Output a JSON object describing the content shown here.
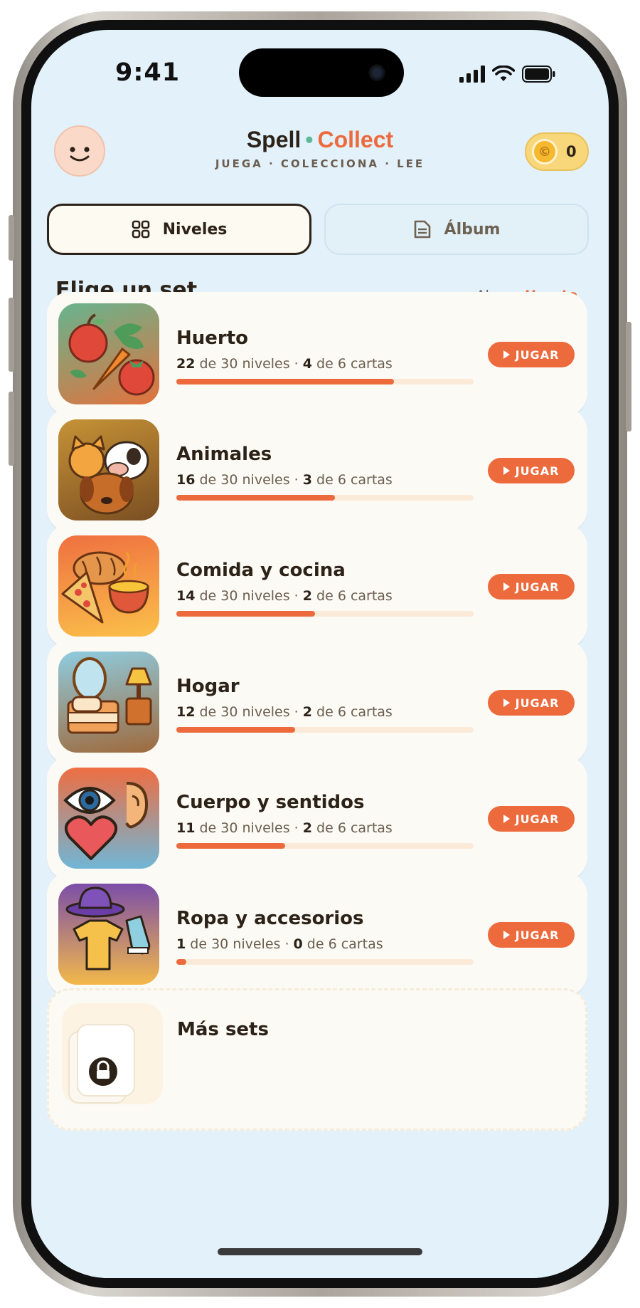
{
  "status": {
    "time": "9:41"
  },
  "app": {
    "title_part1": "Spell",
    "title_dot": "•",
    "title_part2": "Collect",
    "tagline": "JUEGA · COLECCIONA · LEE",
    "coin_symbol": "©",
    "coins": "0"
  },
  "tabs": [
    {
      "label": "Niveles",
      "icon": "grid-icon",
      "active": true
    },
    {
      "label": "Álbum",
      "icon": "album-icon",
      "active": false
    }
  ],
  "section": {
    "title": "Elige un set",
    "current_label": "Ahora:",
    "current_value": "Huerto"
  },
  "sets": [
    {
      "name": "Huerto",
      "levels_done": "22",
      "levels_text": " de 30 niveles · ",
      "cards_done": "4",
      "cards_text": " de 6 cartas",
      "progress": 0.733,
      "play_label": "JUGAR",
      "icon": "vegetables-icon"
    },
    {
      "name": "Animales",
      "levels_done": "16",
      "levels_text": " de 30 niveles · ",
      "cards_done": "3",
      "cards_text": " de 6 cartas",
      "progress": 0.533,
      "play_label": "JUGAR",
      "icon": "animals-icon"
    },
    {
      "name": "Comida y cocina",
      "levels_done": "14",
      "levels_text": " de 30 niveles · ",
      "cards_done": "2",
      "cards_text": " de 6 cartas",
      "progress": 0.467,
      "play_label": "JUGAR",
      "icon": "food-icon"
    },
    {
      "name": "Hogar",
      "levels_done": "12",
      "levels_text": " de 30 niveles · ",
      "cards_done": "2",
      "cards_text": " de 6 cartas",
      "progress": 0.4,
      "play_label": "JUGAR",
      "icon": "home-bed-icon"
    },
    {
      "name": "Cuerpo y sentidos",
      "levels_done": "11",
      "levels_text": " de 30 niveles · ",
      "cards_done": "2",
      "cards_text": " de 6 cartas",
      "progress": 0.367,
      "play_label": "JUGAR",
      "icon": "senses-icon"
    },
    {
      "name": "Ropa y accesorios",
      "levels_done": "1",
      "levels_text": " de 30 niveles · ",
      "cards_done": "0",
      "cards_text": " de 6 cartas",
      "progress": 0.033,
      "play_label": "JUGAR",
      "icon": "clothes-icon"
    }
  ],
  "more": {
    "title": "Más sets",
    "icon": "lock-icon"
  },
  "colors": {
    "accent": "#ec6a3c",
    "background": "#e2f1fa",
    "card": "#fcfaf4",
    "text": "#2c2218",
    "dot": "#5fb89a"
  }
}
